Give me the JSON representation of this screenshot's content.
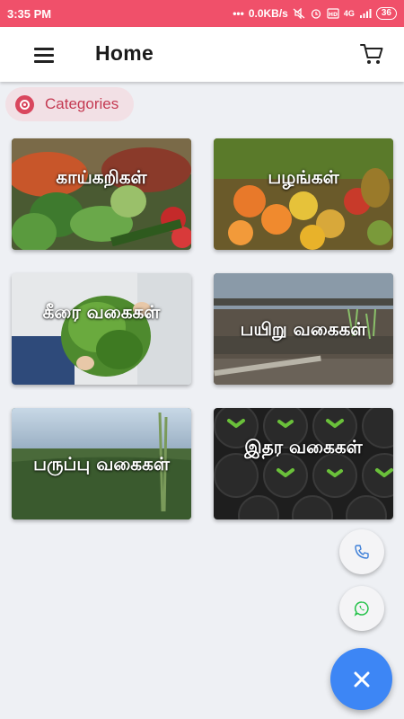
{
  "status_bar": {
    "time": "3:35 PM",
    "network_speed": "0.0KB/s",
    "network_type": "4G",
    "battery": "36",
    "icons": [
      "more-dots-icon",
      "mute-icon",
      "alarm-icon",
      "volte-icon",
      "signal-icon",
      "battery-icon"
    ]
  },
  "header": {
    "title": "Home",
    "menu_icon": "hamburger-menu-icon",
    "cart_icon": "shopping-cart-icon"
  },
  "chip": {
    "label": "Categories",
    "icon": "target-icon"
  },
  "categories": [
    {
      "label": "காய்கறிகள்"
    },
    {
      "label": "பழங்கள்"
    },
    {
      "label": "கீரை வகைகள்"
    },
    {
      "label": "பயிறு வகைகள்"
    },
    {
      "label": "பருப்பு வகைகள்"
    },
    {
      "label": "இதர வகைகள்"
    }
  ],
  "fabs": {
    "phone_icon": "phone-icon",
    "whatsapp_icon": "whatsapp-icon",
    "close_icon": "close-icon"
  },
  "colors": {
    "status_bar": "#f0506a",
    "chip_bg": "#f2e0e5",
    "chip_accent": "#d9475e",
    "fab_main": "#3d86f5",
    "whatsapp": "#25c24a",
    "phone": "#3d7fd8",
    "background": "#eef0f4"
  }
}
